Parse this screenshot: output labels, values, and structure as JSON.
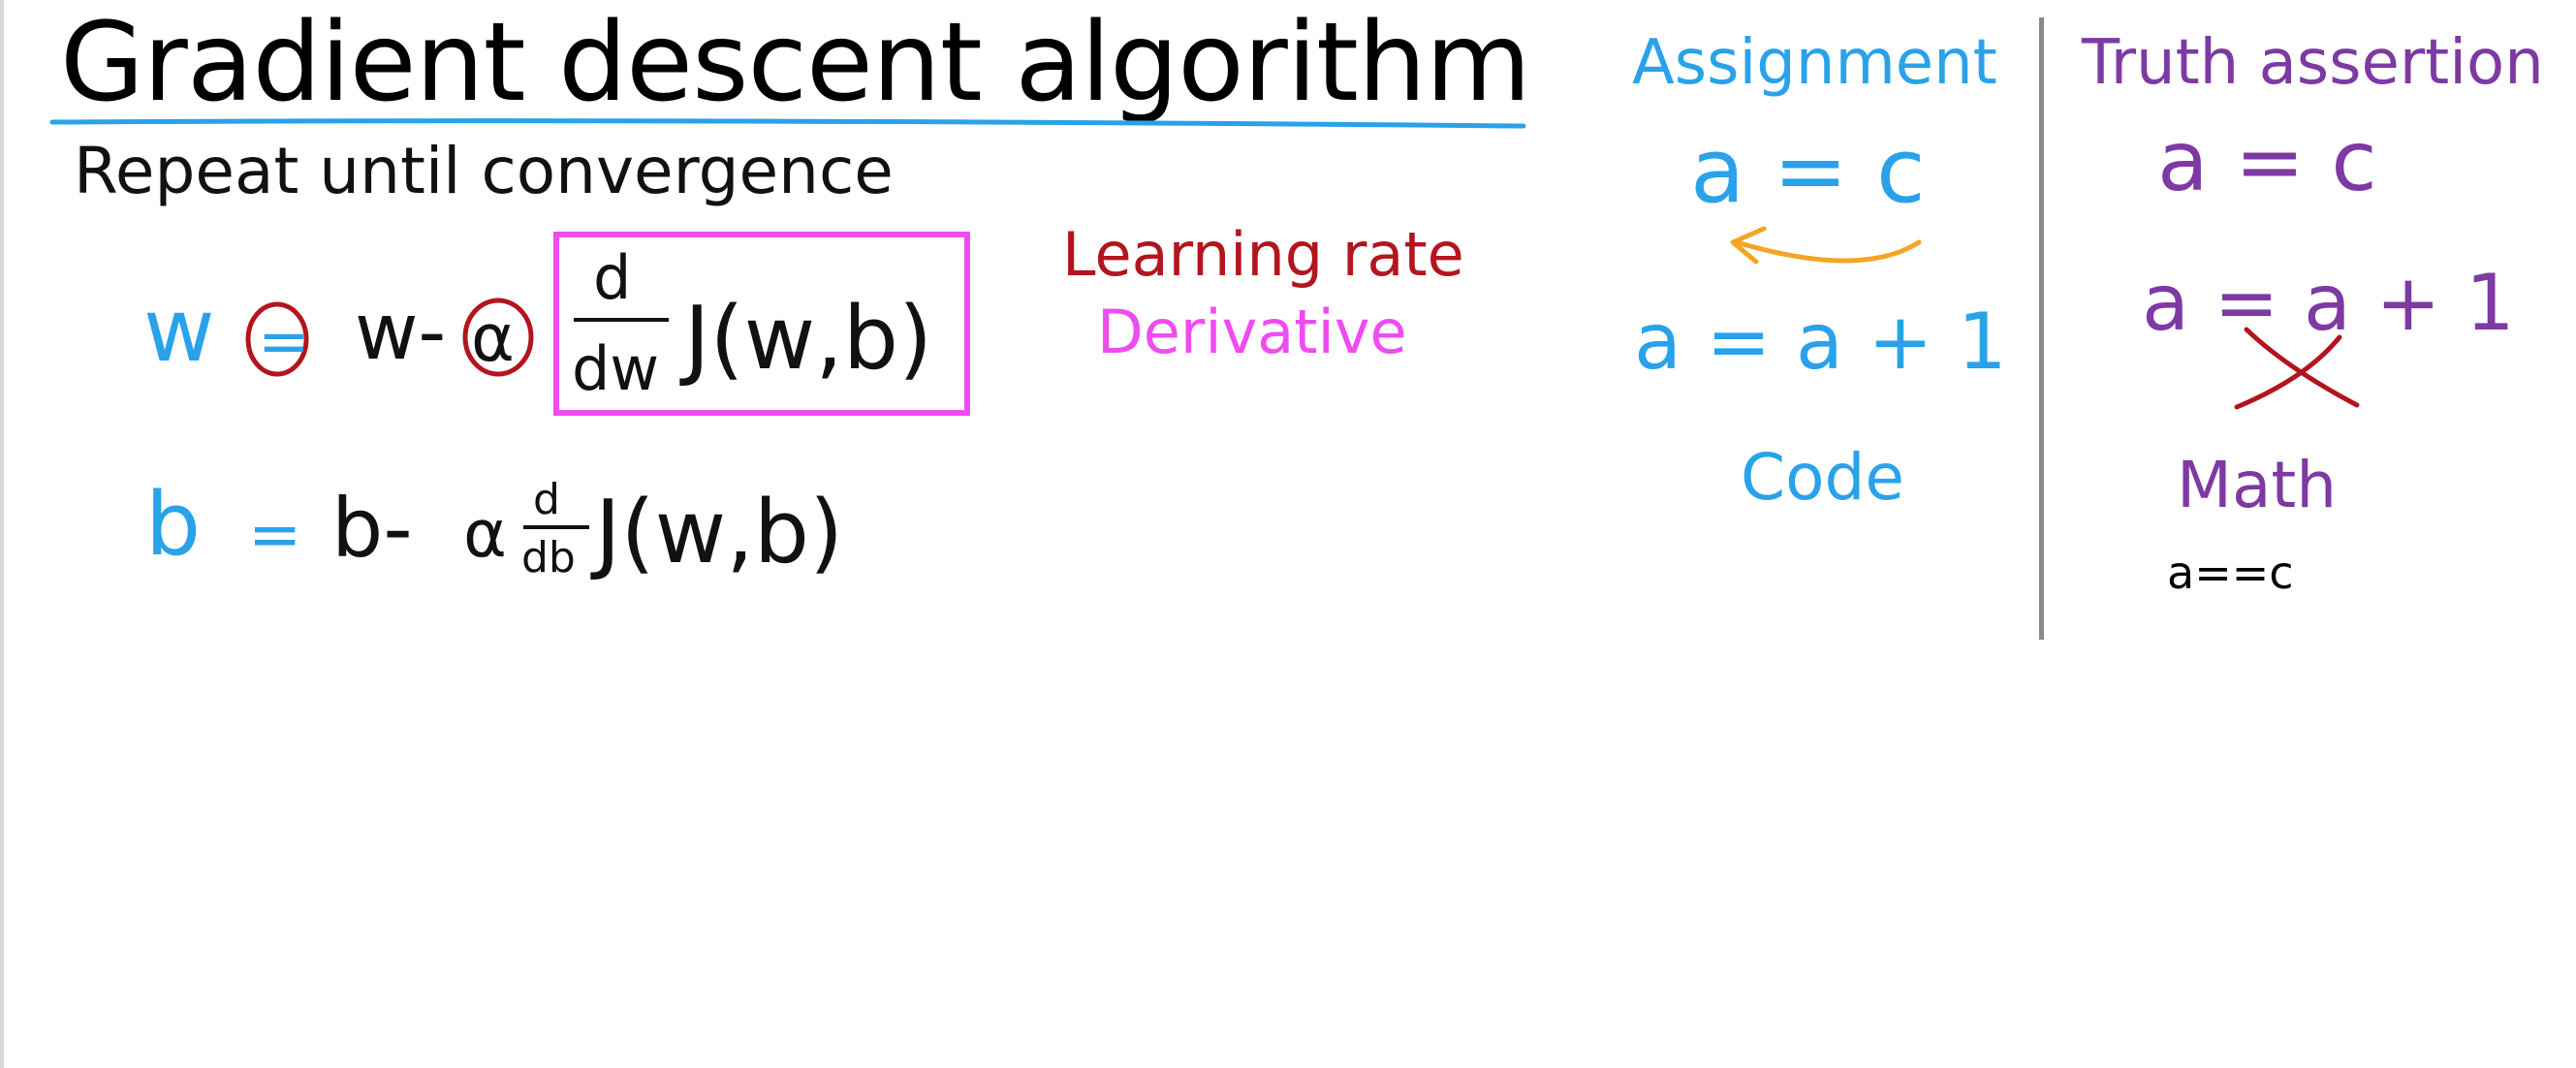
{
  "slide": {
    "title": "Gradient descent algorithm",
    "subtitle": "Repeat until convergence"
  },
  "equations": {
    "w_update": {
      "lhs": "w",
      "assign": "=",
      "w_term": "w-",
      "alpha": "α",
      "d_num": "d",
      "d_den": "dw",
      "cost": "J(w,b)"
    },
    "b_update": {
      "lhs": "b",
      "assign": "=",
      "b_term": "b-",
      "alpha": "α",
      "d_num": "d",
      "d_den": "db",
      "cost": "J(w,b)"
    }
  },
  "labels": {
    "learning_rate": "Learning rate",
    "derivative": "Derivative"
  },
  "assignment": {
    "heading": "Assignment",
    "example1": "a = c",
    "example2": "a = a + 1",
    "footer": "Code"
  },
  "truth": {
    "heading": "Truth assertion",
    "example1": "a = c",
    "example2": "a = a + 1",
    "footer": "Math",
    "code_form": "a==c"
  },
  "colors": {
    "blue": "#2aa2ea",
    "red": "#b3151e",
    "magenta": "#ee4cf0",
    "purple": "#7d3aa3",
    "orange": "#f2a623",
    "divider": "#8a8a8a"
  }
}
